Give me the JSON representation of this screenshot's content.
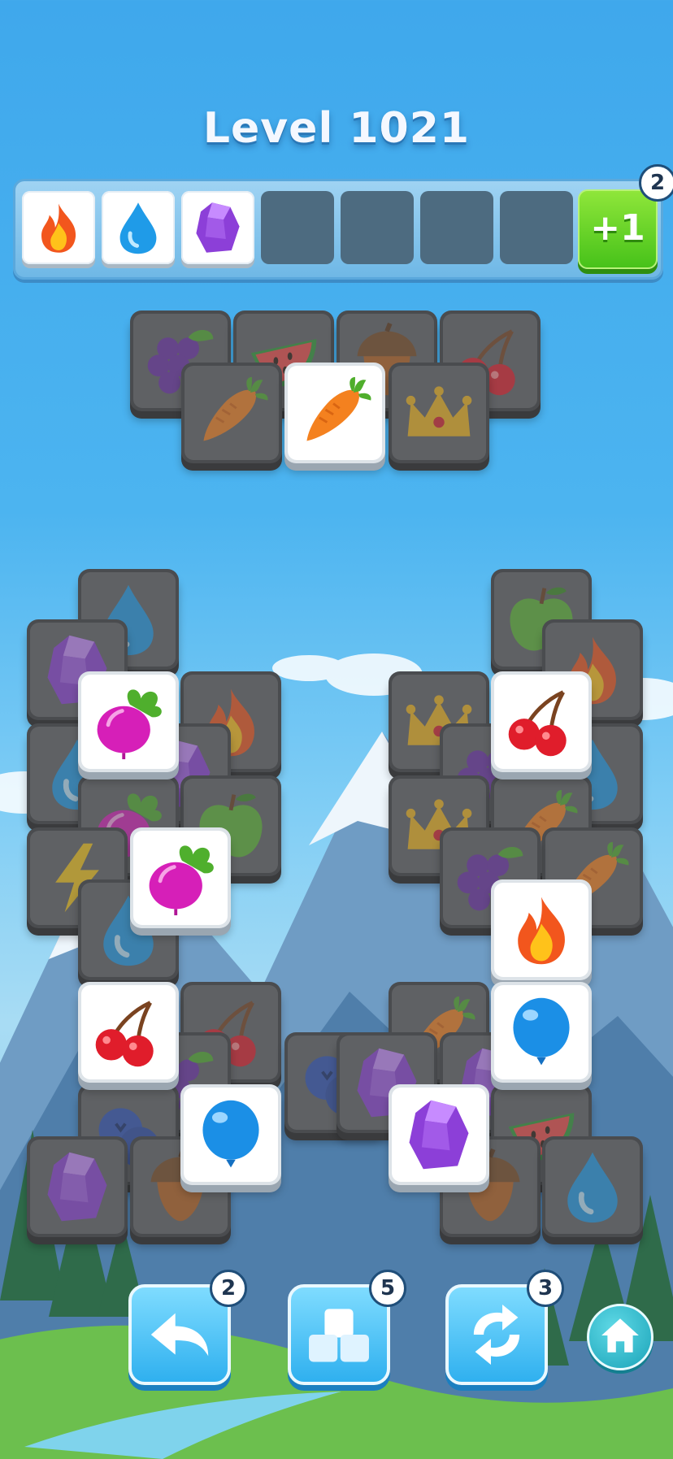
{
  "level": {
    "title": "Level 1021"
  },
  "tray": {
    "slots": [
      {
        "icon": "fire-icon"
      },
      {
        "icon": "water-drop-icon"
      },
      {
        "icon": "purple-crystal-icon"
      },
      {
        "icon": ""
      },
      {
        "icon": ""
      },
      {
        "icon": ""
      },
      {
        "icon": ""
      }
    ],
    "extra_slot_button": {
      "label": "+1",
      "count": "2"
    }
  },
  "tools": {
    "undo": {
      "icon": "undo-arrow-icon",
      "count": "2"
    },
    "magnet": {
      "icon": "tile-stack-icon",
      "count": "5"
    },
    "shuffle": {
      "icon": "shuffle-icon",
      "count": "3"
    },
    "home": {
      "icon": "home-icon"
    }
  },
  "colors": {
    "sky": "#4cb4f0",
    "tile_face": "#ffffff",
    "tile_locked": "#5f6164",
    "plus_button": "#47c21a",
    "tool_button": "#2fb0ef"
  }
}
